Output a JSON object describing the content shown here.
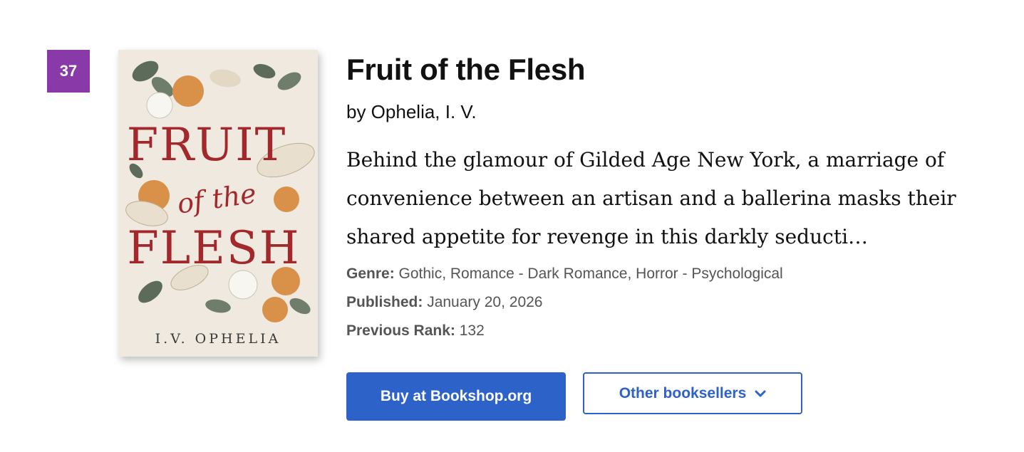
{
  "rank": "37",
  "book": {
    "title": "Fruit of the Flesh",
    "author_line": "by Ophelia, I. V.",
    "description": "Behind the glamour of Gilded Age New York, a marriage of convenience between an artisan and a ballerina masks their shared appetite for revenge in this darkly seducti…",
    "cover": {
      "title_line1": "FRUIT",
      "title_line2": "of the",
      "title_line3": "FLESH",
      "author": "I.V. OPHELIA"
    }
  },
  "meta": {
    "genre_label": "Genre:",
    "genre_value": "Gothic, Romance - Dark Romance, Horror - Psychological",
    "published_label": "Published:",
    "published_value": "January 20, 2026",
    "previous_rank_label": "Previous Rank:",
    "previous_rank_value": "132"
  },
  "actions": {
    "buy_label": "Buy at Bookshop.org",
    "other_label": "Other booksellers",
    "other_icon": "chevron-down-icon"
  },
  "colors": {
    "badge": "#8a3aa8",
    "accent": "#2d63c8",
    "cover_bg": "#efe9df",
    "cover_title": "#a3282c"
  }
}
